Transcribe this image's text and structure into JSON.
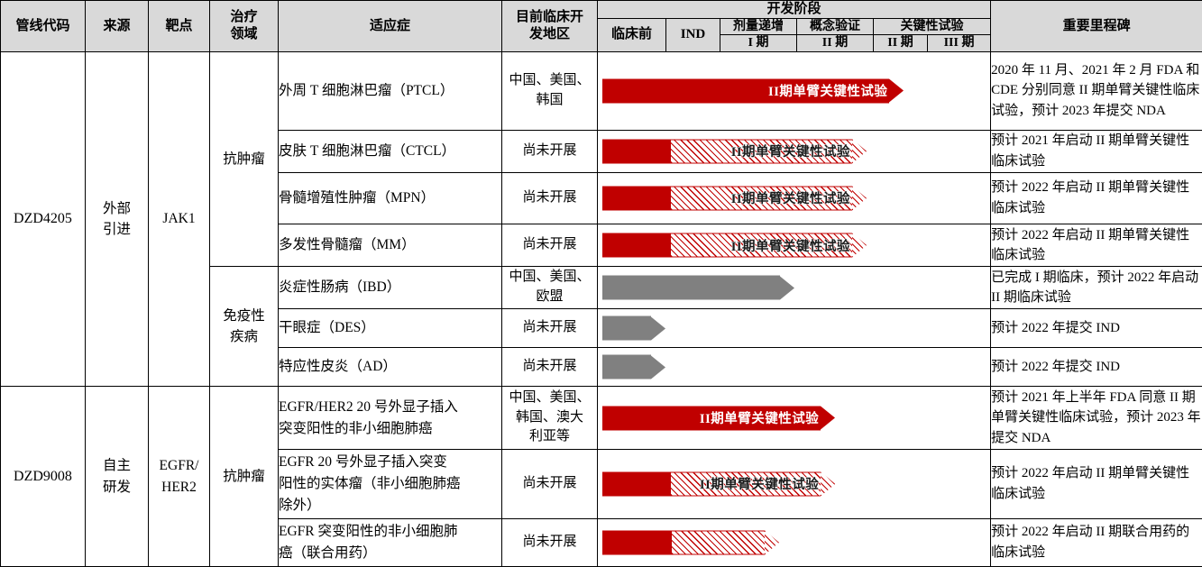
{
  "header": {
    "col_code": "管线代码",
    "col_source": "来源",
    "col_target": "靶点",
    "col_area": "治疗\n领域",
    "col_area_l1": "治疗",
    "col_area_l2": "领域",
    "col_indication": "适应症",
    "col_region_l1": "目前临床开",
    "col_region_l2": "发地区",
    "col_stage_group": "开发阶段",
    "col_preclinical": "临床前",
    "col_ind": "IND",
    "col_dose_esc": "剂量递增",
    "col_poc": "概念验证",
    "col_pivotal": "关键性试验",
    "col_phase1": "I 期",
    "col_phase2a": "II 期",
    "col_phase2b": "II 期",
    "col_phase3": "III 期",
    "col_milestone": "重要里程碑"
  },
  "colors": {
    "red": "#c00000",
    "grey": "#808080",
    "header_bg": "#d9d9d9",
    "border": "#000000"
  },
  "drugs": [
    {
      "code": "DZD4205",
      "source_l1": "外部",
      "source_l2": "引进",
      "target": "JAK1",
      "areas": [
        {
          "name": "抗肿瘤",
          "rowspan": 4
        },
        {
          "name_l1": "免疫性",
          "name_l2": "疾病",
          "rowspan": 3
        }
      ]
    },
    {
      "code": "DZD9008",
      "source_l1": "自主",
      "source_l2": "研发",
      "target_l1": "EGFR/",
      "target_l2": "HER2",
      "areas": [
        {
          "name": "抗肿瘤",
          "rowspan": 3
        }
      ]
    }
  ],
  "rows": [
    {
      "indication": "外周 T 细胞淋巴瘤（PTCL）",
      "region": "中国、美国、\n韩国",
      "region_l1": "中国、美国、",
      "region_l2": "韩国",
      "bar": {
        "type": "solid",
        "color": "red",
        "start_pct": 0,
        "end_pct": 78.0,
        "label": "II期单臂关键性试验",
        "label_visible": true,
        "label_style": "light"
      },
      "milestone": "2020 年 11 月、2021 年 2 月 FDA 和 CDE 分别同意 II 期单臂关键性临床试验，预计 2023 年提交 NDA"
    },
    {
      "indication": "皮肤 T 细胞淋巴瘤（CTCL）",
      "region": "尚未开展",
      "bar": {
        "type": "split",
        "color": "red",
        "start_pct": 0,
        "solid_pct": 17.5,
        "end_pct": 68.5,
        "label": "II期单臂关键性试验",
        "label_visible": true,
        "label_style": "dark"
      },
      "milestone": "预计 2021 年启动 II 期单臂关键性临床试验"
    },
    {
      "indication": "骨髓增殖性肿瘤（MPN）",
      "region": "尚未开展",
      "bar": {
        "type": "split",
        "color": "red",
        "start_pct": 0,
        "solid_pct": 17.5,
        "end_pct": 68.5,
        "label": "II期单臂关键性试验",
        "label_visible": true,
        "label_style": "dark"
      },
      "milestone": "预计 2022 年启动 II 期单臂关键性临床试验"
    },
    {
      "indication": "多发性骨髓瘤（MM）",
      "region": "尚未开展",
      "bar": {
        "type": "split",
        "color": "red",
        "start_pct": 0,
        "solid_pct": 17.5,
        "end_pct": 68.5,
        "label": "II期单臂关键性试验",
        "label_visible": true,
        "label_style": "dark"
      },
      "milestone": "预计 2022 年启动 II 期单臂关键性临床试验"
    },
    {
      "indication": "炎症性肠病（IBD）",
      "region": "中国、美国、\n欧盟",
      "region_l1": "中国、美国、",
      "region_l2": "欧盟",
      "bar": {
        "type": "solid",
        "color": "grey",
        "start_pct": 0,
        "end_pct": 50.0,
        "label": "",
        "label_visible": false,
        "label_style": "light"
      },
      "milestone": "已完成 I 期临床，预计 2022 年启动 II 期临床试验"
    },
    {
      "indication": "干眼症（DES）",
      "region": "尚未开展",
      "bar": {
        "type": "solid",
        "color": "grey",
        "start_pct": 0,
        "end_pct": 17.0,
        "label": "",
        "label_visible": false,
        "label_style": "light"
      },
      "milestone": "预计 2022 年提交 IND"
    },
    {
      "indication": "特应性皮炎（AD）",
      "region": "尚未开展",
      "bar": {
        "type": "solid",
        "color": "grey",
        "start_pct": 0,
        "end_pct": 17.0,
        "label": "",
        "label_visible": false,
        "label_style": "light"
      },
      "milestone": "预计 2022 年提交 IND"
    },
    {
      "indication": "EGFR/HER2 20 号外显子插入\n突变阳性的非小细胞肺癌",
      "indication_l1": "EGFR/HER2 20 号外显子插入",
      "indication_l2": "突变阳性的非小细胞肺癌",
      "region": "中国、美国、\n韩国、澳大\n利亚等",
      "region_l1": "中国、美国、",
      "region_l2": "韩国、澳大",
      "region_l3": "利亚等",
      "bar": {
        "type": "solid",
        "color": "red",
        "start_pct": 0,
        "end_pct": 60.5,
        "label": "II期单臂关键性试验",
        "label_visible": true,
        "label_style": "light"
      },
      "milestone": "预计 2021 年上半年 FDA 同意 II 期单臂关键性临床试验，预计 2023 年提交 NDA"
    },
    {
      "indication": "EGFR 20 号外显子插入突变\n阳性的实体瘤（非小细胞肺癌\n除外）",
      "indication_l1": "EGFR 20 号外显子插入突变",
      "indication_l2": "阳性的实体瘤（非小细胞肺癌",
      "indication_l3": "除外）",
      "region": "尚未开展",
      "bar": {
        "type": "split",
        "color": "red",
        "start_pct": 0,
        "solid_pct": 17.5,
        "end_pct": 60.5,
        "label": "II期单臂关键性试验",
        "label_visible": true,
        "label_style": "dark"
      },
      "milestone": "预计 2022 年启动 II 期单臂关键性临床试验"
    },
    {
      "indication": "EGFR 突变阳性的非小细胞肺\n癌（联合用药）",
      "indication_l1": "EGFR 突变阳性的非小细胞肺",
      "indication_l2": "癌（联合用药）",
      "region": "尚未开展",
      "bar": {
        "type": "split",
        "color": "red",
        "start_pct": 0,
        "solid_pct": 17.5,
        "end_pct": 46.0,
        "label": "",
        "label_visible": false,
        "label_style": "dark"
      },
      "milestone": "预计 2022 年启动 II 期联合用药的临床试验"
    }
  ]
}
